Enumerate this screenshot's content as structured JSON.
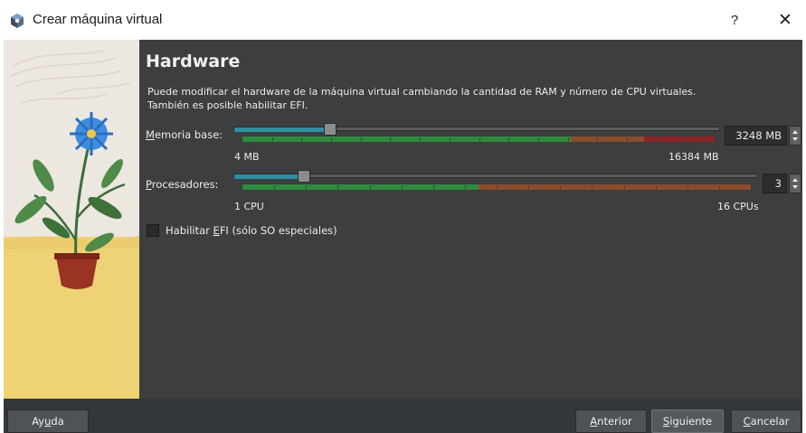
{
  "window": {
    "title": "Crear máquina virtual",
    "help_label": "?",
    "close_label": "✕"
  },
  "page": {
    "heading": "Hardware",
    "description_line1": "Puede modificar el hardware de la máquina virtual cambiando la cantidad de RAM y número de CPU virtuales.",
    "description_line2": "También es posible habilitar EFI."
  },
  "memory": {
    "label_mnemonic": "M",
    "label_rest": "emoria base:",
    "value": "3248 MB",
    "value_mb": 3248,
    "min_label": "4 MB",
    "max_label": "16384 MB",
    "min_mb": 4,
    "max_mb": 16384
  },
  "processors": {
    "label_mnemonic": "P",
    "label_rest": "rocesadores:",
    "value": "3",
    "value_num": 3,
    "min_label": "1 CPU",
    "max_label": "16 CPUs",
    "min": 1,
    "max": 16
  },
  "efi": {
    "label_pre": "Habilitar ",
    "label_mnemonic": "E",
    "label_post": "FI (sólo SO especiales)",
    "checked": false
  },
  "footer": {
    "help_pre": "Ay",
    "help_mnemonic": "u",
    "help_post": "da",
    "back_mnemonic": "A",
    "back_rest": "nterior",
    "next_mnemonic": "S",
    "next_rest": "iguiente",
    "cancel_mnemonic": "C",
    "cancel_rest": "ancelar"
  },
  "colors": {
    "zone_green": "#2e8a3c",
    "zone_orange": "#8a4d2c",
    "zone_red": "#8c2626",
    "slider_fill": "#2f8fa1",
    "panel_bg": "#3c3e40"
  }
}
